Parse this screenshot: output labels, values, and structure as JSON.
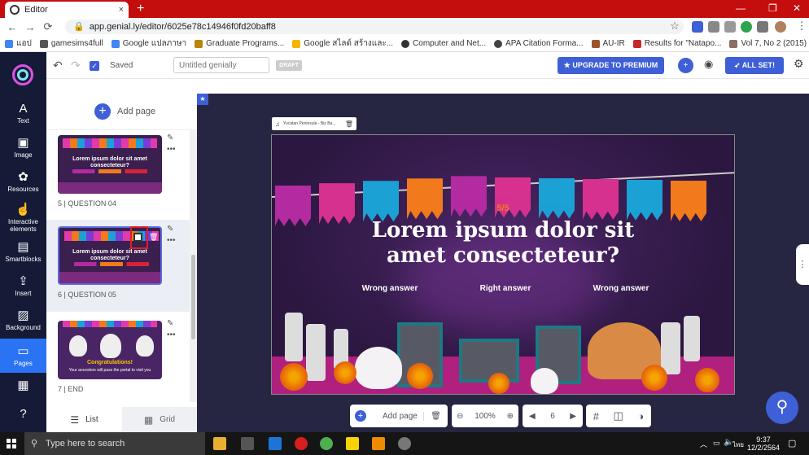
{
  "browser": {
    "tab_title": "Editor",
    "tab_close": "×",
    "new_tab": "+",
    "url": "app.genial.ly/editor/6025e78c14946f0fd20baff8",
    "window_controls": [
      "—",
      "❐",
      "✕"
    ],
    "bookmarks": [
      {
        "label": "แอป",
        "color": "#4285f4"
      },
      {
        "label": "gamesims4full",
        "color": "#555555"
      },
      {
        "label": "Google แปลภาษา",
        "color": "#4285f4"
      },
      {
        "label": "Graduate Programs...",
        "color": "#b8860b"
      },
      {
        "label": "Google สไลด์ สร้างและ...",
        "color": "#f4b400"
      },
      {
        "label": "Computer and Net...",
        "color": "#333333"
      },
      {
        "label": "APA Citation Forma...",
        "color": "#444444"
      },
      {
        "label": "AU-IR",
        "color": "#a0522d"
      },
      {
        "label": "Results for \"Natapo...",
        "color": "#c62828"
      },
      {
        "label": "Vol 7, No 2 (2015)",
        "color": "#8d6e63"
      }
    ]
  },
  "leftnav": {
    "items": [
      {
        "label": "Text",
        "icon": "A"
      },
      {
        "label": "Image",
        "icon": "▣"
      },
      {
        "label": "Resources",
        "icon": "✿"
      },
      {
        "label": "Interactive elements",
        "icon": "☝"
      },
      {
        "label": "Smartblocks",
        "icon": "▤"
      },
      {
        "label": "Insert",
        "icon": "⇪"
      },
      {
        "label": "Background",
        "icon": "▨"
      },
      {
        "label": "Pages",
        "icon": "▭"
      },
      {
        "label": "",
        "icon": "▦"
      },
      {
        "label": "",
        "icon": "?"
      }
    ]
  },
  "topbar": {
    "undo": "↶",
    "redo": "↷",
    "saved": "Saved",
    "title_placeholder": "Untitled genially",
    "draft": "DRAFT",
    "upgrade": "UPGRADE TO PREMIUM",
    "all_set": "ALL SET!"
  },
  "panel": {
    "add_page": "Add page",
    "pages": [
      {
        "label": "5 |  QUESTION 04",
        "thumb_title": "Lorem ipsum dolor sit amet consecteteur?"
      },
      {
        "label": "6 |  QUESTION 05",
        "thumb_title": "Lorem ipsum dolor sit amet consecteteur?"
      },
      {
        "label": "7 |  END",
        "thumb_title": "Congratulations!",
        "thumb_sub": "Your ancestors will pass the portal to visit you"
      }
    ],
    "list_tab": "List",
    "grid_tab": "Grid"
  },
  "slide": {
    "music": "Yucatan Peninsula - Biz Ba...",
    "counter": "5/5",
    "question_line1": "Lorem ipsum dolor sit",
    "question_line2": "amet consecteteur?",
    "answers": [
      {
        "label": "Wrong answer",
        "color": "#b42aa0"
      },
      {
        "label": "Right answer",
        "color": "#f07a1c"
      },
      {
        "label": "Wrong answer",
        "color": "#d8223a"
      }
    ],
    "flag_colors": [
      "#b42aa0",
      "#d6318f",
      "#1ba1d4",
      "#f07a1c",
      "#b42aa0",
      "#d6318f",
      "#1ba1d4",
      "#d6318f",
      "#1ba1d4",
      "#f07a1c"
    ]
  },
  "bottombar": {
    "add_page": "Add page",
    "zoom": "100%",
    "page_number": "6"
  },
  "taskbar": {
    "search_placeholder": "Type here to search",
    "time": "9:37",
    "date": "12/2/2564",
    "lang": "ไทย"
  }
}
